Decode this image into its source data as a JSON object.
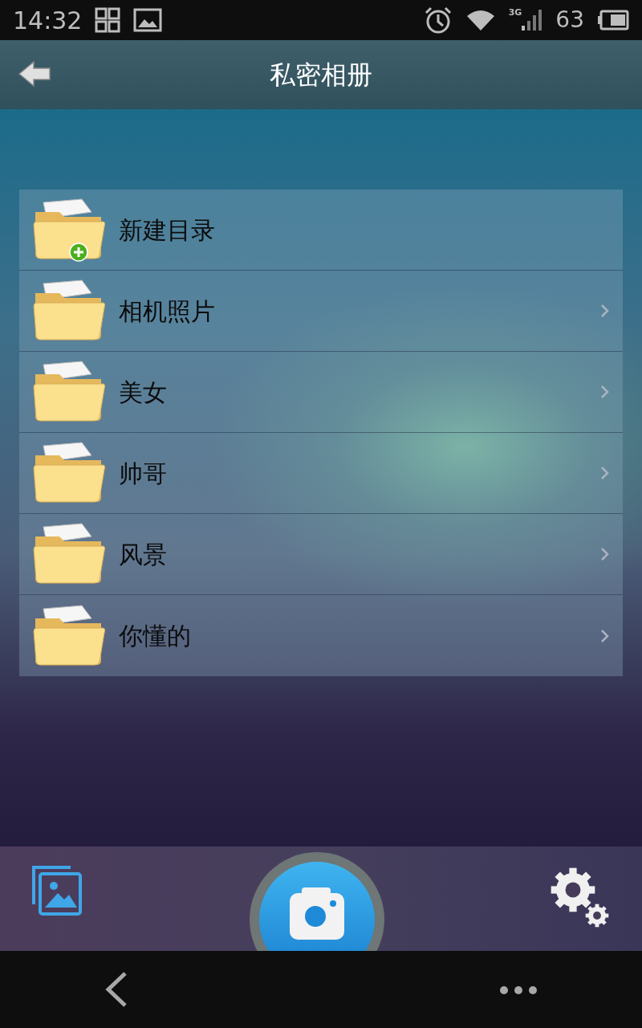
{
  "status_bar": {
    "time": "14:32",
    "network": "3G",
    "battery": "63"
  },
  "app_bar": {
    "title": "私密相册"
  },
  "folders": [
    {
      "kind": "new",
      "label": "新建目录"
    },
    {
      "kind": "folder",
      "label": "相机照片"
    },
    {
      "kind": "folder",
      "label": "美女"
    },
    {
      "kind": "folder",
      "label": "帅哥"
    },
    {
      "kind": "folder",
      "label": "风景"
    },
    {
      "kind": "folder",
      "label": "你懂的"
    }
  ]
}
